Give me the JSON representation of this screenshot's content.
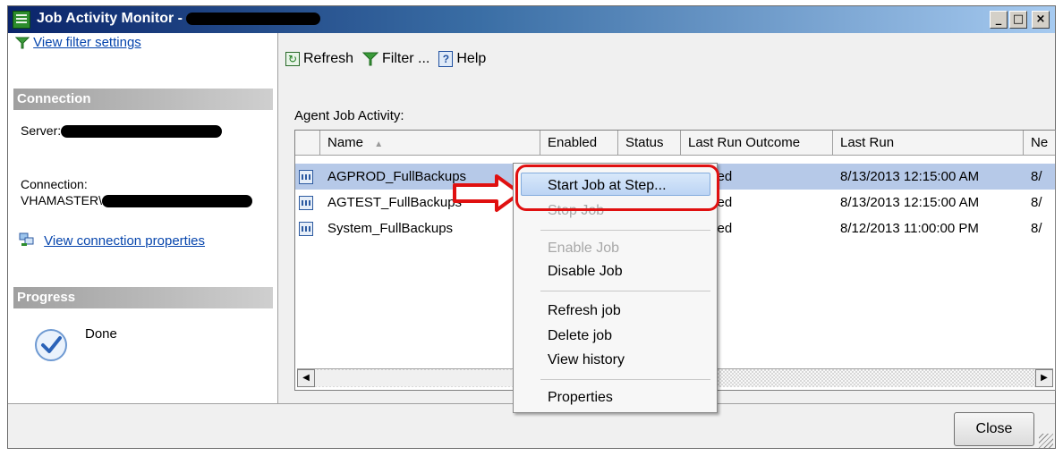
{
  "window": {
    "title": "Job Activity Monitor - ",
    "minimize_glyph": "_",
    "maximize_glyph": "□",
    "close_glyph": "×"
  },
  "left_pane": {
    "filter_link": "View filter settings",
    "connection_header": "Connection",
    "server_label": "Server:",
    "connection_label": "Connection:",
    "connection_value": "VHAMASTER\\",
    "connection_properties_link": "View connection properties",
    "progress_header": "Progress",
    "progress_status": "Done"
  },
  "toolbar": {
    "refresh_label": "Refresh",
    "filter_label": "Filter ...",
    "help_label": "Help",
    "refresh_glyph": "↻",
    "help_glyph": "?"
  },
  "grid": {
    "caption": "Agent Job Activity:",
    "columns": [
      "Name",
      "Enabled",
      "Status",
      "Last Run Outcome",
      "Last Run",
      "Ne"
    ],
    "sort_glyph": "▲",
    "rows": [
      {
        "name": "AGPROD_FullBackups",
        "last_run_outcome": "ceeded",
        "last_run": "8/13/2013 12:15:00 AM",
        "next": "8/"
      },
      {
        "name": "AGTEST_FullBackups",
        "last_run_outcome": "ceeded",
        "last_run": "8/13/2013 12:15:00 AM",
        "next": "8/"
      },
      {
        "name": "System_FullBackups",
        "last_run_outcome": "ceeded",
        "last_run": "8/12/2013 11:00:00 PM",
        "next": "8/"
      }
    ],
    "scroll_left_glyph": "◀",
    "scroll_right_glyph": "▶"
  },
  "context_menu": {
    "start_job": "Start Job at Step...",
    "stop_job": "Stop Job",
    "enable_job": "Enable Job",
    "disable_job": "Disable Job",
    "refresh_job": "Refresh job",
    "delete_job": "Delete job",
    "view_history": "View history",
    "properties": "Properties"
  },
  "footer": {
    "close_label": "Close"
  },
  "colors": {
    "title_bar": "#0a246a",
    "highlight_row": "#b6c9e8",
    "annotation_red": "#e01010",
    "link": "#0645ad"
  }
}
